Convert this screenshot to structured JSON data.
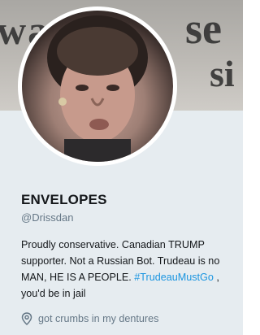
{
  "profile": {
    "banner_words": [
      "wa",
      "se",
      "si"
    ],
    "display_name": "ENVELOPES",
    "handle": "@Drissdan",
    "bio_text": "Proudly conservative. Canadian TRUMP supporter. Not a Russian Bot. Trudeau is no MAN, HE IS A PEOPLE.",
    "bio_hashtag": "#TrudeauMustGo",
    "bio_tail": " , you'd be in jail",
    "location": "got crumbs in my dentures"
  },
  "colors": {
    "card_background": "#e6ecf0",
    "link": "#1b95e0",
    "secondary_text": "#657786"
  },
  "icons": {
    "location": "map-pin-icon"
  }
}
